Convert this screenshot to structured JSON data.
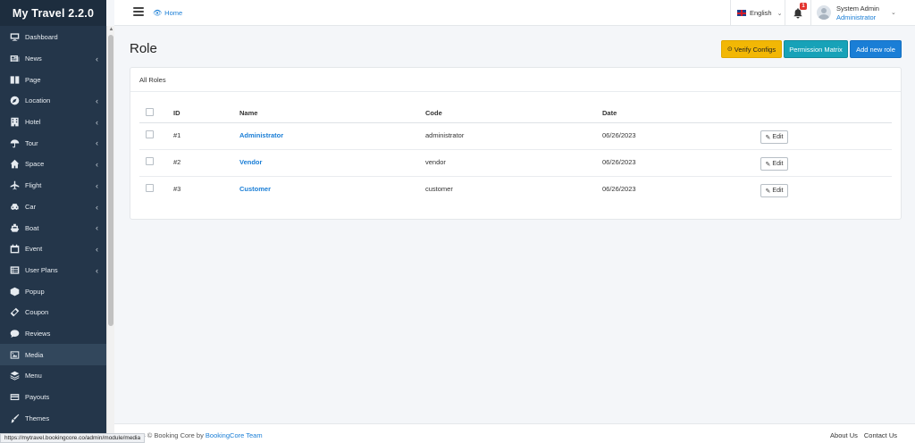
{
  "app": {
    "title": "My Travel 2.2.0"
  },
  "sidebar": {
    "items": [
      {
        "label": "Dashboard",
        "icon": "monitor-icon",
        "has_children": false
      },
      {
        "label": "News",
        "icon": "newspaper-icon",
        "has_children": true
      },
      {
        "label": "Page",
        "icon": "book-icon",
        "has_children": false
      },
      {
        "label": "Location",
        "icon": "compass-icon",
        "has_children": true
      },
      {
        "label": "Hotel",
        "icon": "building-icon",
        "has_children": true
      },
      {
        "label": "Tour",
        "icon": "umbrella-icon",
        "has_children": true
      },
      {
        "label": "Space",
        "icon": "home-icon",
        "has_children": true
      },
      {
        "label": "Flight",
        "icon": "plane-icon",
        "has_children": true
      },
      {
        "label": "Car",
        "icon": "car-icon",
        "has_children": true
      },
      {
        "label": "Boat",
        "icon": "ship-icon",
        "has_children": true
      },
      {
        "label": "Event",
        "icon": "calendar-icon",
        "has_children": true
      },
      {
        "label": "User Plans",
        "icon": "list-icon",
        "has_children": true
      },
      {
        "label": "Popup",
        "icon": "cube-icon",
        "has_children": false
      },
      {
        "label": "Coupon",
        "icon": "ticket-icon",
        "has_children": false
      },
      {
        "label": "Reviews",
        "icon": "comment-icon",
        "has_children": false
      },
      {
        "label": "Media",
        "icon": "image-icon",
        "has_children": false,
        "active": true
      },
      {
        "label": "Menu",
        "icon": "layers-icon",
        "has_children": false
      },
      {
        "label": "Payouts",
        "icon": "credit-card-icon",
        "has_children": false
      },
      {
        "label": "Themes",
        "icon": "brush-icon",
        "has_children": false
      }
    ]
  },
  "header": {
    "breadcrumb_home": "Home",
    "language": "English",
    "notification_count": "1",
    "user_name": "System Admin",
    "user_role": "Administrator"
  },
  "page": {
    "title": "Role",
    "buttons": {
      "verify": "Verify Configs",
      "matrix": "Permission Matrix",
      "add": "Add new role"
    },
    "panel_title": "All Roles",
    "table": {
      "columns": [
        "ID",
        "Name",
        "Code",
        "Date"
      ],
      "rows": [
        {
          "id": "#1",
          "name": "Administrator",
          "code": "administrator",
          "date": "06/26/2023"
        },
        {
          "id": "#2",
          "name": "Vendor",
          "code": "vendor",
          "date": "06/26/2023"
        },
        {
          "id": "#3",
          "name": "Customer",
          "code": "customer",
          "date": "06/26/2023"
        }
      ],
      "edit_label": "Edit"
    }
  },
  "footer": {
    "copyright": "2023 © Booking Core by",
    "team": "BookingCore Team",
    "links": [
      "About Us",
      "Contact Us"
    ]
  },
  "status_bar": {
    "url": "https://mytravel.bookingcore.co/admin/module/media"
  }
}
